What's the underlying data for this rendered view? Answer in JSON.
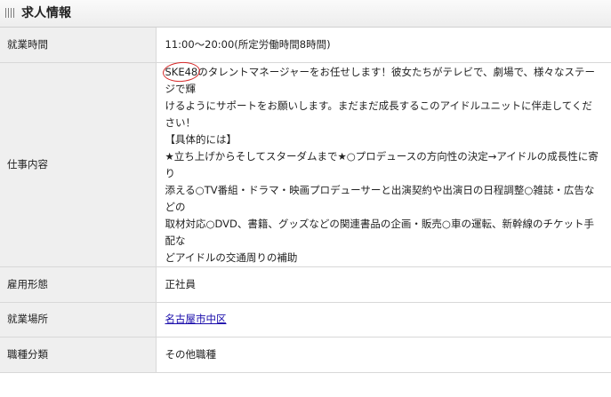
{
  "section": {
    "title": "求人情報",
    "icon": "grid-icon"
  },
  "rows": {
    "hours": {
      "label": "就業時間",
      "value": "11:00～20:00(所定労働時間8時間)"
    },
    "job": {
      "label": "仕事内容",
      "highlight": "SKE48",
      "line1": "のタレントマネージャーをお任せします！彼女たちがテレビで、劇場で、様々なステージで輝",
      "line2": "けるようにサポートをお願いします。まだまだ成長するこのアイドルユニットに伴走してください！",
      "line3": "【具体的には】",
      "line4": "★立ち上げからそしてスターダムまで★○プロデュースの方向性の決定→アイドルの成長性に寄り",
      "line5": "添える○TV番組・ドラマ・映画プロデューサーと出演契約や出演日の日程調整○雑誌・広告などの",
      "line6": "取材対応○DVD、書籍、グッズなどの関連書品の企画・販売○車の運転、新幹線のチケット手配な",
      "line7": "どアイドルの交通周りの補助"
    },
    "employment": {
      "label": "雇用形態",
      "value": "正社員"
    },
    "location": {
      "label": "就業場所",
      "value": "名古屋市中区"
    },
    "category": {
      "label": "職種分類",
      "value": "その他職種"
    }
  },
  "colors": {
    "annotation_circle": "#d62828",
    "link": "#1a0dab",
    "label_bg": "#efefef"
  }
}
